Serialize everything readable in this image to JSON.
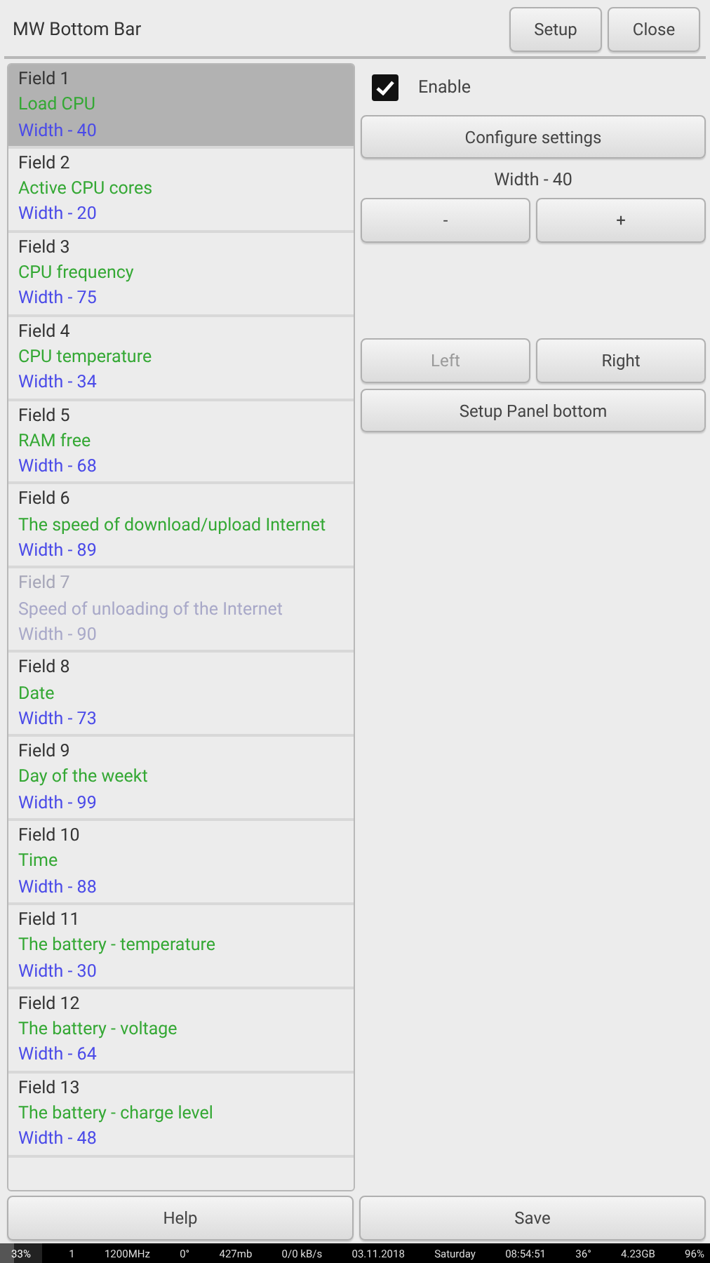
{
  "window": {
    "title": "MW Bottom Bar"
  },
  "header_buttons": [
    "Setup",
    "Close"
  ],
  "fields": [
    {
      "name": "Field 1",
      "description": "Load CPU",
      "width": "Width - 40",
      "selected": true,
      "disabled": false
    },
    {
      "name": "Field 2",
      "description": "Active CPU cores",
      "width": "Width - 20",
      "selected": false,
      "disabled": false
    },
    {
      "name": "Field 3",
      "description": "CPU frequency",
      "width": "Width - 75",
      "selected": false,
      "disabled": false
    },
    {
      "name": "Field 4",
      "description": "CPU temperature",
      "width": "Width - 34",
      "selected": false,
      "disabled": false
    },
    {
      "name": "Field 5",
      "description": "RAM free",
      "width": "Width - 68",
      "selected": false,
      "disabled": false
    },
    {
      "name": "Field 6",
      "description": "The speed of download/upload Internet",
      "width": "Width - 89",
      "selected": false,
      "disabled": false
    },
    {
      "name": "Field 7",
      "description": "Speed of unloading of the Internet",
      "width": "Width - 90",
      "selected": false,
      "disabled": true
    },
    {
      "name": "Field 8",
      "description": "Date",
      "width": "Width - 73",
      "selected": false,
      "disabled": false
    },
    {
      "name": "Field 9",
      "description": "Day of the weekt",
      "width": "Width - 99",
      "selected": false,
      "disabled": false
    },
    {
      "name": "Field 10",
      "description": "Time",
      "width": "Width - 88",
      "selected": false,
      "disabled": false
    },
    {
      "name": "Field 11",
      "description": "The battery - temperature",
      "width": "Width - 30",
      "selected": false,
      "disabled": false
    },
    {
      "name": "Field 12",
      "description": "The battery - voltage",
      "width": "Width - 64",
      "selected": false,
      "disabled": false
    },
    {
      "name": "Field 13",
      "description": "The battery - charge level",
      "width": "Width - 48",
      "selected": false,
      "disabled": false
    }
  ],
  "settings": {
    "enable": {
      "label": "Enable",
      "checked": true
    },
    "configure_button": "Configure settings",
    "width_label": "Width - 40",
    "minus_button": "-",
    "plus_button": "+",
    "left_button": {
      "label": "Left",
      "disabled": true
    },
    "right_button": {
      "label": "Right",
      "disabled": false
    },
    "setup_panel_button": "Setup Panel bottom"
  },
  "footer_buttons": [
    {
      "label": "Help",
      "disabled": false
    },
    {
      "label": "Save",
      "disabled": false
    }
  ],
  "status_bar": [
    {
      "text": "33%",
      "level": 0.33
    },
    {
      "text": "1"
    },
    {
      "text": "1200MHz"
    },
    {
      "text": "0°"
    },
    {
      "text": "427mb"
    },
    {
      "text": "0/0 kB/s"
    },
    {
      "text": "03.11.2018"
    },
    {
      "text": "Saturday"
    },
    {
      "text": "08:54:51"
    },
    {
      "text": "36°"
    },
    {
      "text": "4.23GB"
    },
    {
      "text": "96%"
    }
  ]
}
